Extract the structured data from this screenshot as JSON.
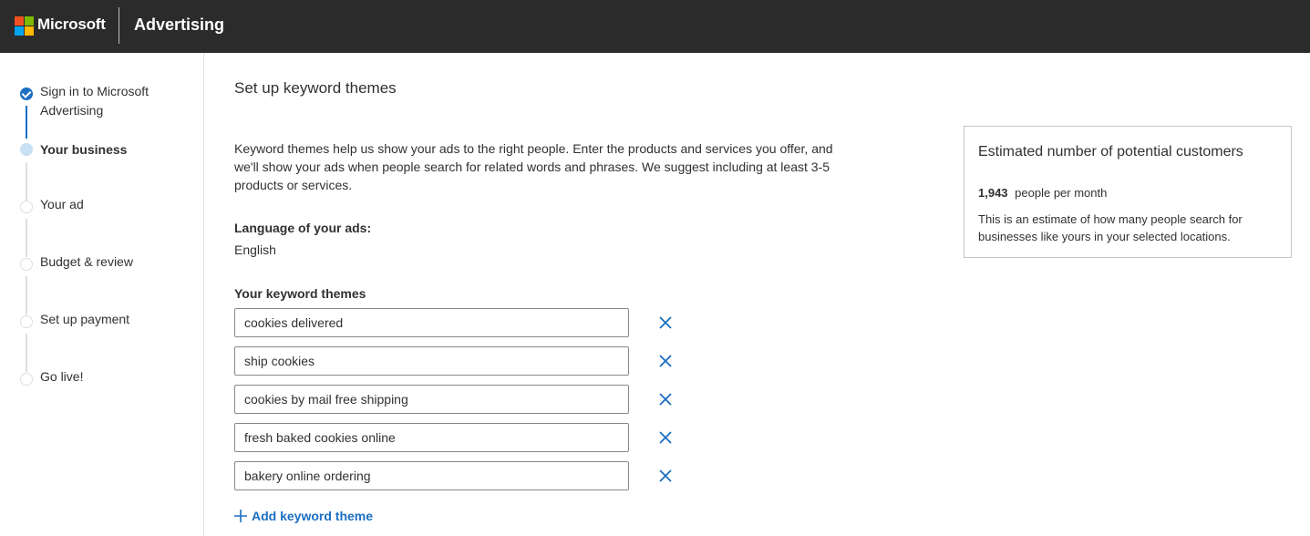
{
  "header": {
    "brand": "Microsoft",
    "product": "Advertising",
    "logo_colors": [
      "#f25022",
      "#7fba00",
      "#00a4ef",
      "#ffb900"
    ],
    "background": "#2b2b2b"
  },
  "steps": [
    {
      "label": "Sign in to Microsoft Advertising",
      "state": "done"
    },
    {
      "label": "Your business",
      "state": "current"
    },
    {
      "label": "Your ad",
      "state": "pending"
    },
    {
      "label": "Budget & review",
      "state": "pending"
    },
    {
      "label": "Set up payment",
      "state": "pending"
    },
    {
      "label": "Go live!",
      "state": "pending"
    }
  ],
  "main": {
    "title": "Set up keyword themes",
    "intro": "Keyword themes help us show your ads to the right people. Enter the products and services you offer, and we'll show your ads when people search for related words and phrases. We suggest including at least 3-5 products or services.",
    "language_label": "Language of your ads:",
    "language_value": "English",
    "themes_label": "Your keyword themes",
    "themes": [
      "cookies delivered",
      "ship cookies",
      "cookies by mail free shipping",
      "fresh baked cookies online",
      "bakery online ordering"
    ],
    "add_label": "Add keyword theme"
  },
  "estimate": {
    "title": "Estimated number of potential customers",
    "count": "1,943",
    "count_suffix": "people per month",
    "note": "This is an estimate of how many people search for businesses like yours in your selected locations."
  },
  "colors": {
    "accent": "#1b6ec2",
    "step_current": "#c7e0f4"
  }
}
